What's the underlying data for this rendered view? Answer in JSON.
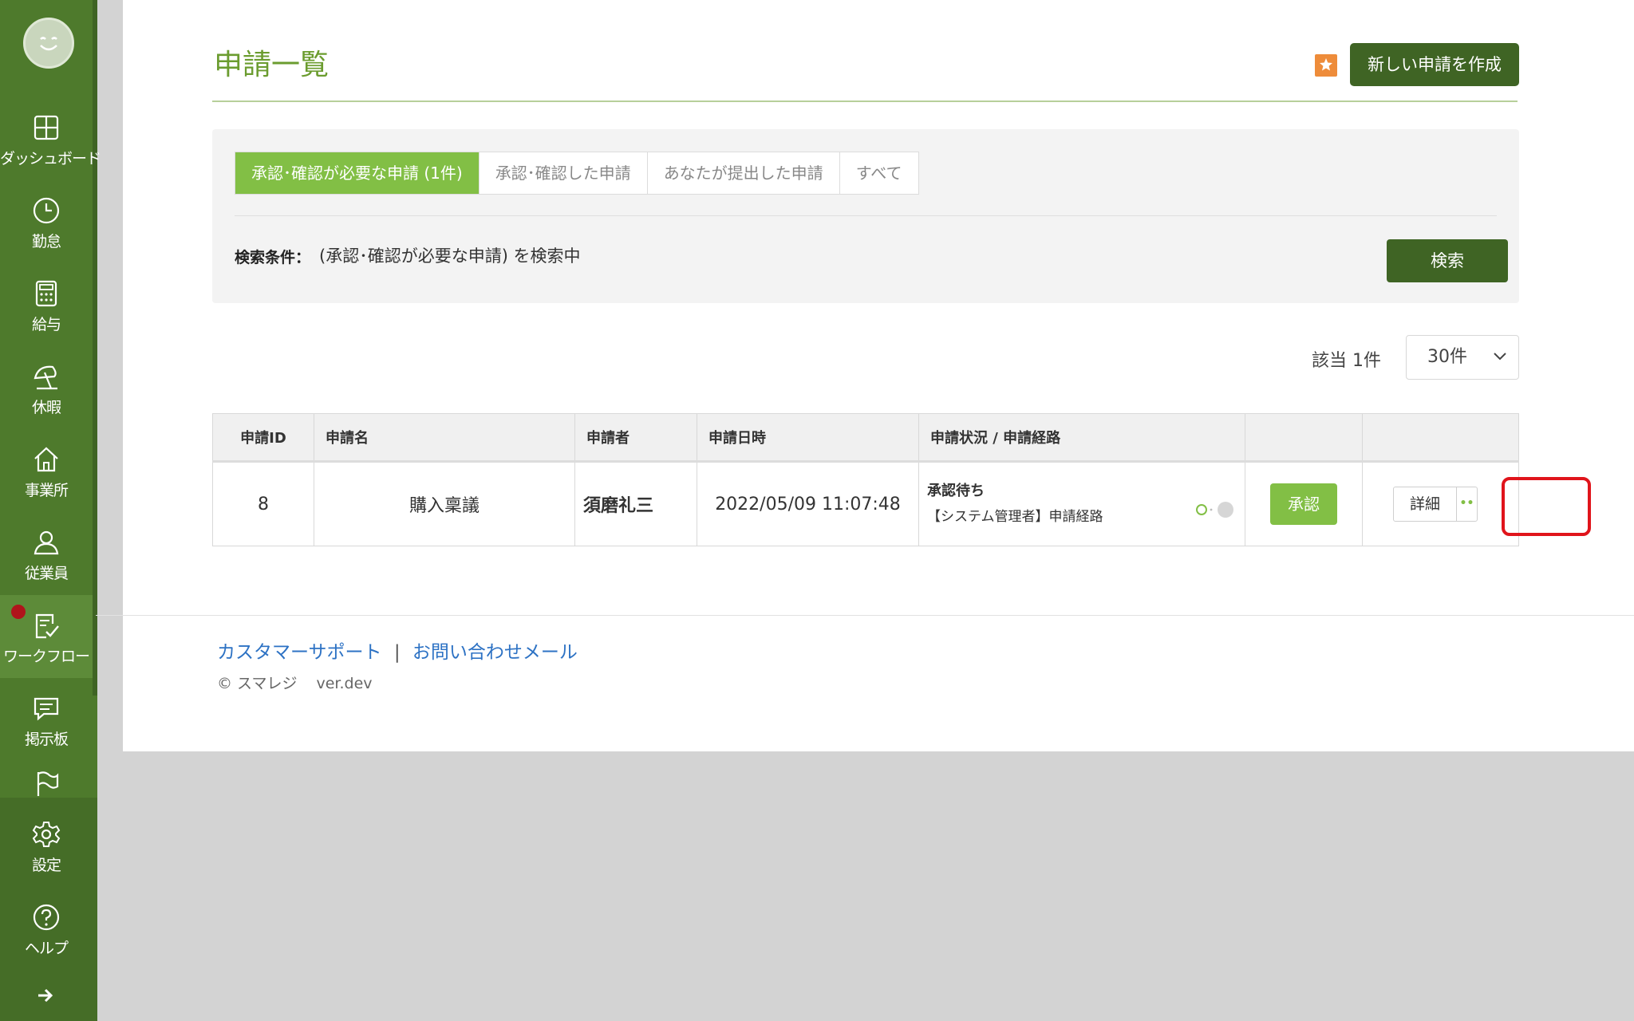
{
  "sidebar": {
    "items": [
      {
        "label": "ダッシュボード",
        "icon": "dashboard-icon"
      },
      {
        "label": "勤怠",
        "icon": "clock-icon"
      },
      {
        "label": "給与",
        "icon": "calculator-icon"
      },
      {
        "label": "休暇",
        "icon": "beach-umbrella-icon"
      },
      {
        "label": "事業所",
        "icon": "home-icon"
      },
      {
        "label": "従業員",
        "icon": "person-icon"
      },
      {
        "label": "ワークフロー",
        "icon": "workflow-check-icon",
        "active": true,
        "has_notification": true
      },
      {
        "label": "掲示板",
        "icon": "chat-bubble-icon"
      },
      {
        "label": "",
        "icon": "flag-icon"
      },
      {
        "label": "設定",
        "icon": "gear-icon"
      },
      {
        "label": "ヘルプ",
        "icon": "help-icon"
      }
    ],
    "expand_icon": "arrow-right-icon"
  },
  "header": {
    "title": "申請一覧",
    "new_button": "新しい申請を作成"
  },
  "filter": {
    "tabs": [
      {
        "label": "承認･確認が必要な申請 (1件)",
        "active": true
      },
      {
        "label": "承認･確認した申請"
      },
      {
        "label": "あなたが提出した申請"
      },
      {
        "label": "すべて"
      }
    ],
    "condition_label": "検索条件：",
    "condition_text": "(承認･確認が必要な申請) を検索中",
    "search_button": "検索"
  },
  "results": {
    "count_text": "該当 1件",
    "per_page": "30件"
  },
  "table": {
    "headers": [
      "申請ID",
      "申請名",
      "申請者",
      "申請日時",
      "申請状況 / 申請経路",
      "",
      ""
    ],
    "rows": [
      {
        "id": "8",
        "name": "購入稟議",
        "applicant": "須磨礼三",
        "datetime": "2022/05/09 11:07:48",
        "status": "承認待ち",
        "route": "【システム管理者】申請経路",
        "approve_label": "承認",
        "detail_label": "詳細"
      }
    ]
  },
  "footer": {
    "support_link": "カスタマーサポート",
    "separator": "|",
    "contact_link": "お問い合わせメール",
    "copyright": "© スマレジ",
    "version": "ver.dev"
  },
  "colors": {
    "sidebar": "#4e7a2c",
    "accent_green": "#82bf45",
    "dark_green": "#3f6424",
    "title_green": "#6b9c2f",
    "link_blue": "#2d72c4",
    "highlight_red": "#e0141b",
    "bookmark_orange": "#ee8c3a"
  }
}
